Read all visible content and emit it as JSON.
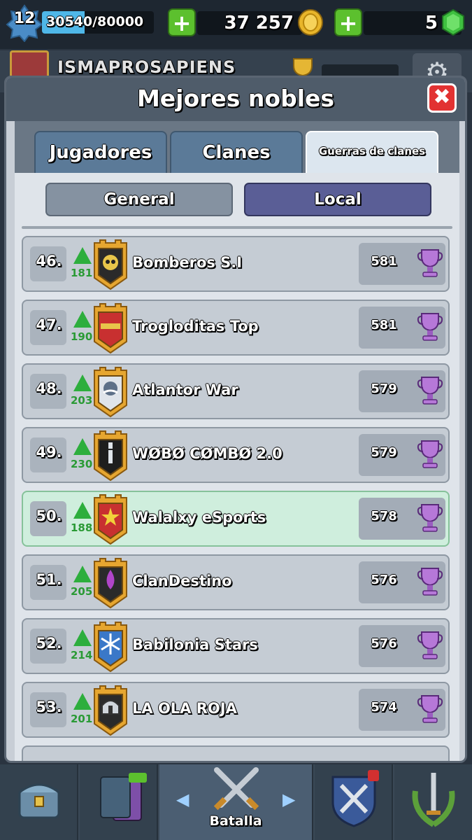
{
  "status_bar": {
    "level": "12",
    "xp_text": "30540/80000",
    "xp_progress": 0.38,
    "plus_symbol": "+",
    "gold": "37 257",
    "gems": "5"
  },
  "profile": {
    "name": "ISMAPROSAPIENS"
  },
  "modal": {
    "title": "Mejores nobles",
    "close_symbol": "✖",
    "tabs": [
      "Jugadores",
      "Clanes",
      "Guerras de clanes"
    ],
    "active_tab": "Guerras de clanes",
    "toggles": [
      "General",
      "Local"
    ],
    "active_toggle": "Local"
  },
  "rankings": [
    {
      "rank": "46.",
      "change": "181",
      "name": "Bomberos S.I",
      "score": "581",
      "badge": "skull-badge"
    },
    {
      "rank": "47.",
      "change": "190",
      "name": "Trogloditas Top",
      "score": "581",
      "badge": "flag-badge"
    },
    {
      "rank": "48.",
      "change": "203",
      "name": "Atlantor War",
      "score": "579",
      "badge": "mustache-badge"
    },
    {
      "rank": "49.",
      "change": "230",
      "name": "WØBØ CØMBØ 2.0",
      "score": "579",
      "badge": "bamboo-badge"
    },
    {
      "rank": "50.",
      "change": "188",
      "name": "Walalxy eSports",
      "score": "578",
      "badge": "star-badge",
      "highlight": true
    },
    {
      "rank": "51.",
      "change": "205",
      "name": "ClanDestino",
      "score": "576",
      "badge": "drop-badge"
    },
    {
      "rank": "52.",
      "change": "214",
      "name": "Babilonia Stars",
      "score": "576",
      "badge": "snowflake-badge"
    },
    {
      "rank": "53.",
      "change": "201",
      "name": "LA OLA ROJA",
      "score": "574",
      "badge": "helmet-badge"
    }
  ],
  "bottom_nav": {
    "active_label": "Batalla"
  },
  "colors": {
    "up_arrow": "#2dae3d",
    "trophy": "#b678d8",
    "highlight_row": "#cfeedd",
    "active_toggle": "#5a5e96"
  }
}
